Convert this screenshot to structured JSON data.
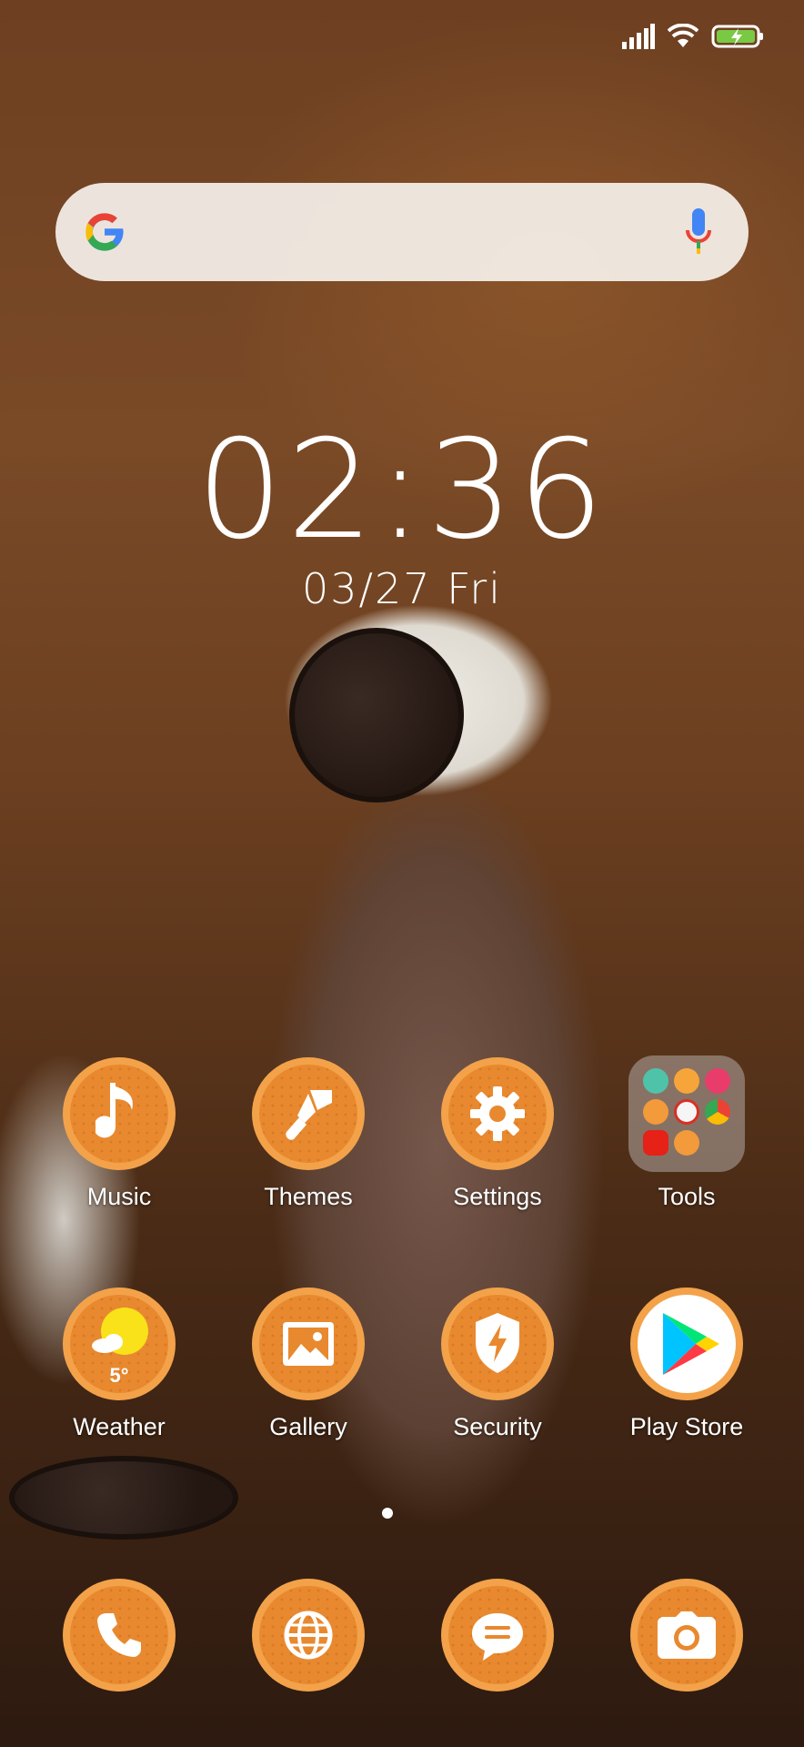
{
  "status": {
    "signal": "signal-icon",
    "wifi": "wifi-icon",
    "battery": "battery-charging-icon"
  },
  "search": {
    "logo": "google-logo-icon",
    "mic": "mic-icon"
  },
  "clock": {
    "time": "02:36",
    "date": "03/27 Fri"
  },
  "apps_row1": [
    {
      "label": "Music",
      "icon": "music-note-icon"
    },
    {
      "label": "Themes",
      "icon": "paintbrush-icon"
    },
    {
      "label": "Settings",
      "icon": "gear-icon"
    },
    {
      "label": "Tools",
      "icon": "folder-icon"
    }
  ],
  "apps_row2": [
    {
      "label": "Weather",
      "icon": "weather-sun-icon",
      "temp": "5°"
    },
    {
      "label": "Gallery",
      "icon": "image-icon"
    },
    {
      "label": "Security",
      "icon": "shield-bolt-icon"
    },
    {
      "label": "Play Store",
      "icon": "play-store-icon"
    }
  ],
  "dock": [
    {
      "icon": "phone-icon"
    },
    {
      "icon": "browser-globe-icon"
    },
    {
      "icon": "messages-icon"
    },
    {
      "icon": "camera-icon"
    }
  ],
  "colors": {
    "cookie_orange": "#e8892f",
    "cookie_rim": "#f3a24a",
    "cookie_edge": "#f7c07a"
  }
}
